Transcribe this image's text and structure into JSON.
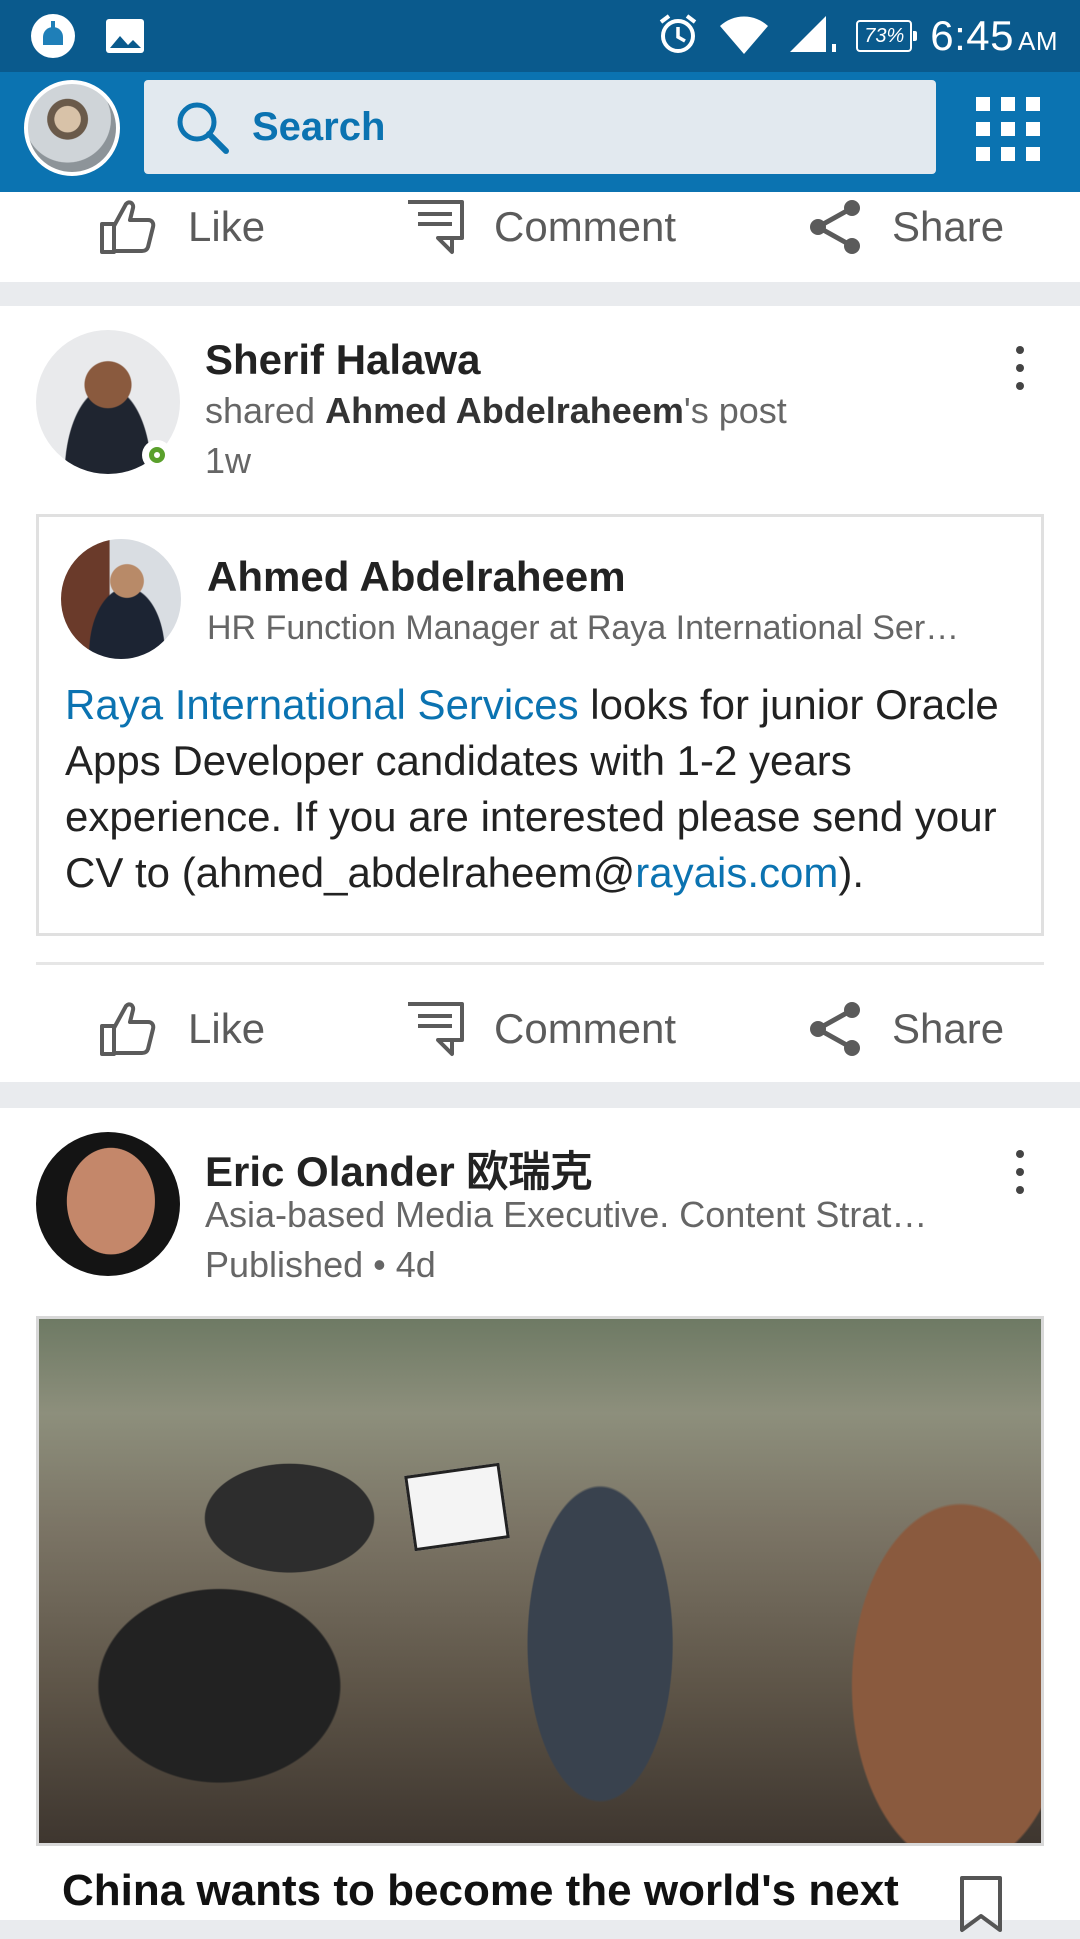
{
  "status_bar": {
    "battery": "73%",
    "time": "6:45",
    "ampm": "AM"
  },
  "app_bar": {
    "search_placeholder": "Search"
  },
  "actions": {
    "like": "Like",
    "comment": "Comment",
    "share": "Share"
  },
  "post1": {
    "author": "Sherif Halawa",
    "shared_prefix": "shared ",
    "shared_name": "Ahmed Abdelraheem",
    "shared_suffix": "'s post",
    "time": "1w",
    "original": {
      "author": "Ahmed Abdelraheem",
      "headline": "HR Function Manager at Raya International Ser…",
      "text_link1": "Raya International Services",
      "text_part1": " looks for junior Oracle Apps Developer candidates with 1-2 years experience. If you are interested please send your CV to (ahmed_abdelraheem@",
      "text_link2": "rayais.com",
      "text_part2": ")."
    }
  },
  "post2": {
    "author": "Eric Olander 欧瑞克",
    "headline": "Asia-based Media Executive. Content Strat…",
    "meta": "Published • 4d",
    "article_title": "China wants to become the world's next"
  },
  "colors": {
    "brand_blue": "#0b73b1",
    "status_bar": "#0a5a8d",
    "online_green": "#5aa02c"
  }
}
